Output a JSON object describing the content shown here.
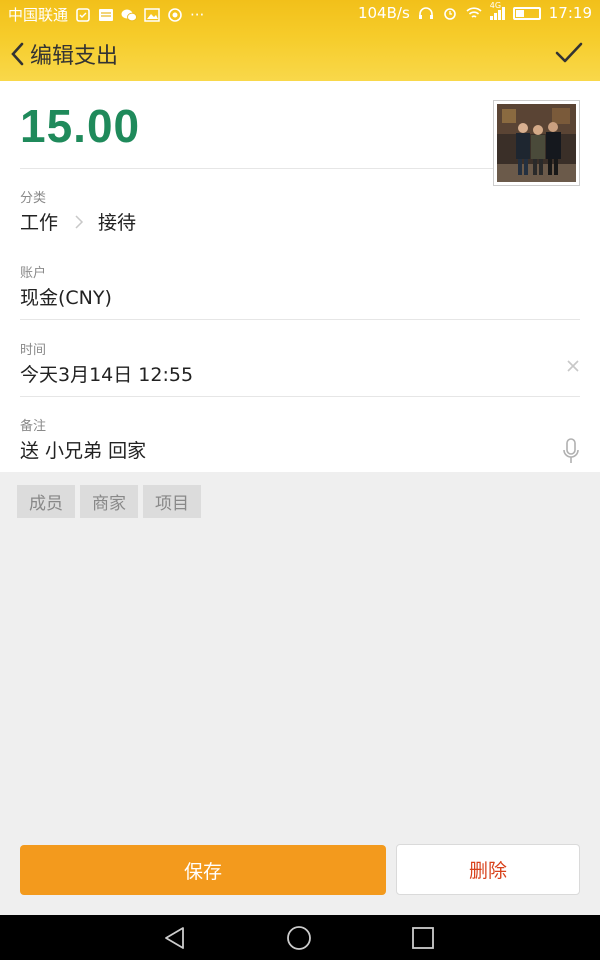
{
  "status_bar": {
    "carrier": "中国联通",
    "ellipsis": "···",
    "network_speed": "104B/s",
    "network_type": "4G",
    "time": "17:19",
    "icons": [
      "sim-icon",
      "sms-icon",
      "wechat-icon",
      "image-icon",
      "app-icon",
      "headphone-icon",
      "alarm-icon",
      "wifi-icon",
      "signal-icon",
      "battery-icon"
    ]
  },
  "header": {
    "title": "编辑支出",
    "back_icon": "chevron-left-icon",
    "confirm_icon": "checkmark-icon"
  },
  "amount": "15.00",
  "fields": {
    "category": {
      "label": "分类",
      "primary": "工作",
      "secondary": "接待"
    },
    "account": {
      "label": "账户",
      "value": "现金(CNY)"
    },
    "time": {
      "label": "时间",
      "value": "今天3月14日 12:55"
    },
    "note": {
      "label": "备注",
      "value": "送 小兄弟 回家"
    }
  },
  "tags": [
    "成员",
    "商家",
    "项目"
  ],
  "actions": {
    "save": "保存",
    "delete": "删除"
  },
  "colors": {
    "header": "#f6cc2a",
    "amount": "#1f8a5b",
    "save_button": "#f39a1d",
    "delete_text": "#d8421c"
  }
}
